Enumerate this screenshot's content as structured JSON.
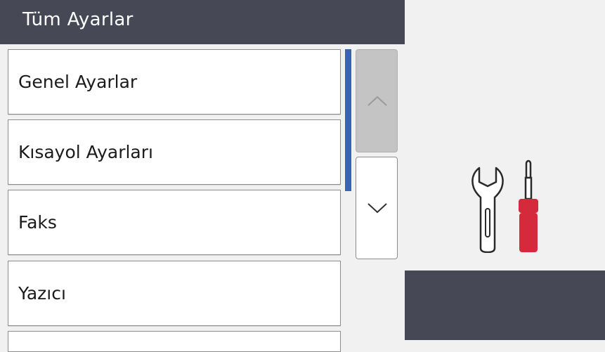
{
  "header": {
    "title": "Tüm Ayarlar"
  },
  "menu": {
    "items": [
      {
        "label": "Genel Ayarlar"
      },
      {
        "label": "Kısayol Ayarları"
      },
      {
        "label": "Faks"
      },
      {
        "label": "Yazıcı"
      },
      {
        "label": ""
      }
    ]
  },
  "scrollbar": {
    "up_icon": "chevron-up-icon",
    "down_icon": "chevron-down-icon",
    "accent_color": "#3a63b8"
  },
  "settings_icon": {
    "name": "wrench-screwdriver-icon",
    "handle_color": "#d42a3c"
  },
  "colors": {
    "header_bg": "#474856",
    "panel_bg": "#f1f1f1"
  }
}
